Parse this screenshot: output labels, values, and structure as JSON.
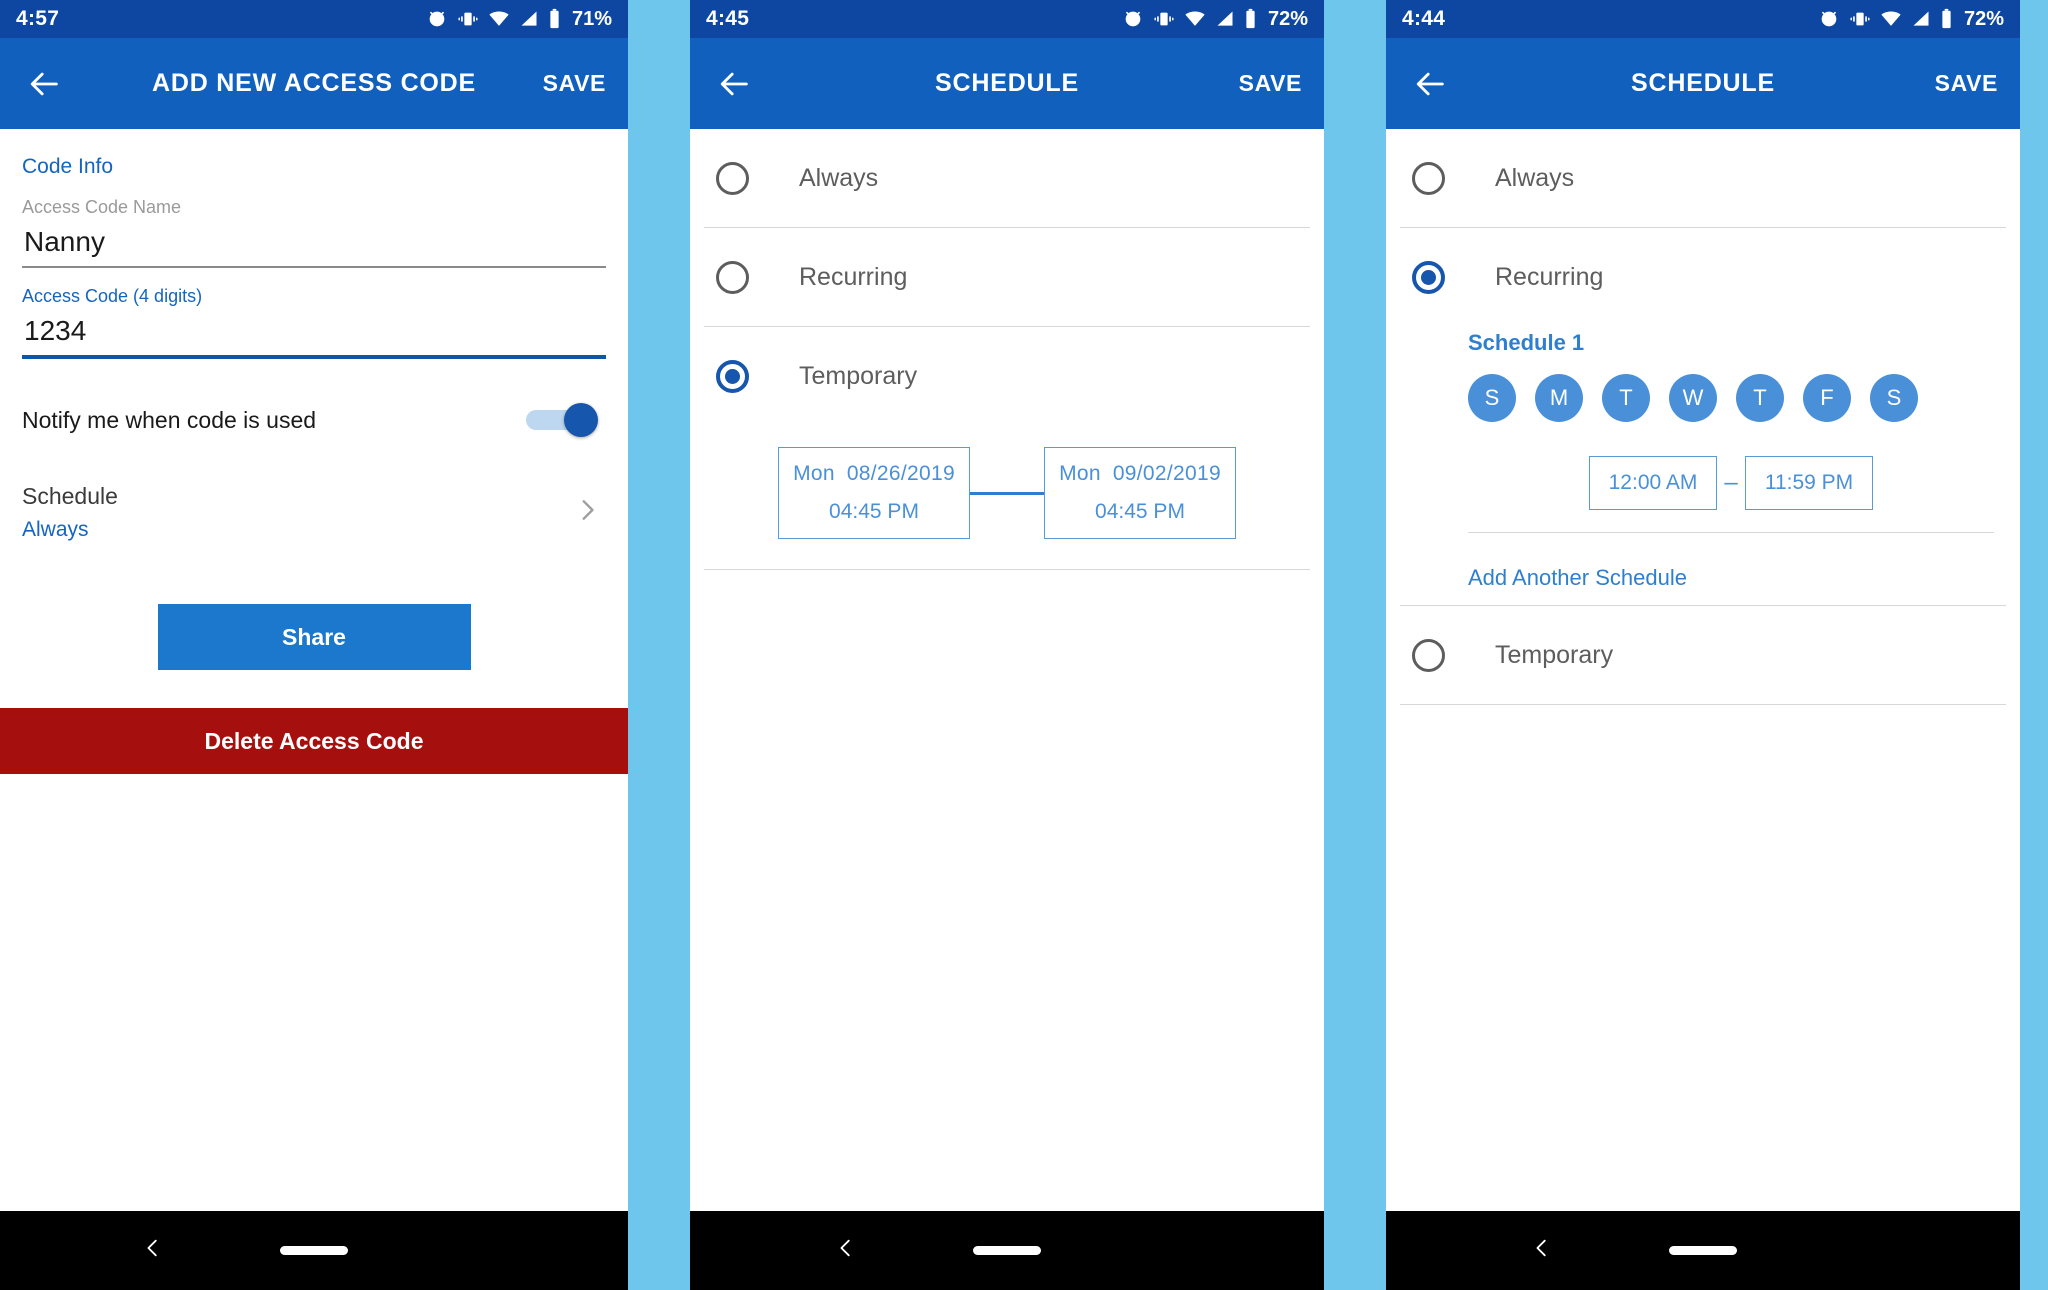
{
  "panels": [
    {
      "status": {
        "time": "4:57",
        "battery": "71%",
        "icons": [
          "alarm-icon",
          "vibrate-icon",
          "wifi-icon",
          "signal-icon",
          "battery-icon"
        ]
      },
      "appbar": {
        "title": "ADD NEW ACCESS CODE",
        "save_label": "SAVE",
        "back_icon": "arrow-left-icon"
      },
      "section_label": "Code Info",
      "name_field": {
        "label": "Access Code Name",
        "value": "Nanny"
      },
      "code_field": {
        "label": "Access Code (4 digits)",
        "value": "1234"
      },
      "notify": {
        "label": "Notify me when code is used",
        "state": "on"
      },
      "schedule": {
        "label": "Schedule",
        "value": "Always",
        "chevron_icon": "chevron-right-icon"
      },
      "share_label": "Share",
      "delete_label": "Delete Access Code"
    },
    {
      "status": {
        "time": "4:45",
        "battery": "72%"
      },
      "appbar": {
        "title": "SCHEDULE",
        "save_label": "SAVE",
        "back_icon": "arrow-left-icon"
      },
      "options": [
        {
          "label": "Always",
          "selected": false
        },
        {
          "label": "Recurring",
          "selected": false
        },
        {
          "label": "Temporary",
          "selected": true
        }
      ],
      "range": {
        "start": {
          "dow": "Mon",
          "date": "08/26/2019",
          "time": "04:45 PM"
        },
        "end": {
          "dow": "Mon",
          "date": "09/02/2019",
          "time": "04:45 PM"
        }
      }
    },
    {
      "status": {
        "time": "4:44",
        "battery": "72%"
      },
      "appbar": {
        "title": "SCHEDULE",
        "save_label": "SAVE",
        "back_icon": "arrow-left-icon"
      },
      "options": [
        {
          "label": "Always",
          "selected": false
        },
        {
          "label": "Recurring",
          "selected": true
        },
        {
          "label": "Temporary",
          "selected": false
        }
      ],
      "recurring": {
        "title": "Schedule 1",
        "days": [
          {
            "letter": "S",
            "on": true
          },
          {
            "letter": "M",
            "on": true
          },
          {
            "letter": "T",
            "on": true
          },
          {
            "letter": "W",
            "on": true
          },
          {
            "letter": "T",
            "on": true
          },
          {
            "letter": "F",
            "on": true
          },
          {
            "letter": "S",
            "on": true
          }
        ],
        "start_time": "12:00 AM",
        "dash": "–",
        "end_time": "11:59 PM",
        "add_label": "Add Another Schedule"
      }
    }
  ],
  "navbar": {
    "back_icon": "nav-back-icon",
    "pill_icon": "home-pill-icon"
  },
  "colors": {
    "status_bar": "#0d47a1",
    "app_bar": "#1260be",
    "accent_blue": "#1565c0",
    "share_blue": "#1b78cc",
    "delete_red": "#a5100f",
    "day_circle": "#4a90d9",
    "gap_blue": "#6ec6ec"
  }
}
